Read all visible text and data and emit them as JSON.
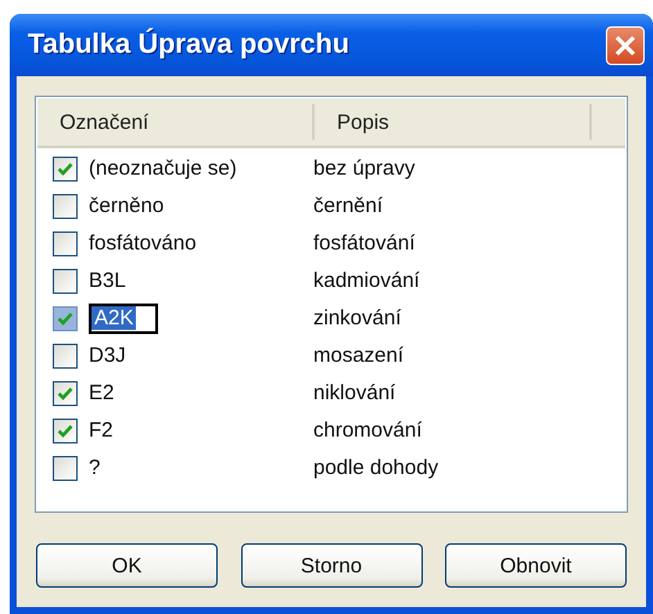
{
  "window": {
    "title": "Tabulka Úprava povrchu"
  },
  "table": {
    "columns": [
      "Označení",
      "Popis"
    ],
    "rows": [
      {
        "code": "(neoznačuje se)",
        "description": "bez úpravy",
        "checked": true,
        "editing": false
      },
      {
        "code": "černěno",
        "description": "černění",
        "checked": false,
        "editing": false
      },
      {
        "code": "fosfátováno",
        "description": "fosfátování",
        "checked": false,
        "editing": false
      },
      {
        "code": "B3L",
        "description": "kadmiování",
        "checked": false,
        "editing": false
      },
      {
        "code": "A2K",
        "description": "zinkování",
        "checked": true,
        "editing": true
      },
      {
        "code": "D3J",
        "description": "mosazení",
        "checked": false,
        "editing": false
      },
      {
        "code": "E2",
        "description": "niklování",
        "checked": true,
        "editing": false
      },
      {
        "code": "F2",
        "description": "chromování",
        "checked": true,
        "editing": false
      },
      {
        "code": "?",
        "description": "podle dohody",
        "checked": false,
        "editing": false
      }
    ]
  },
  "buttons": [
    "OK",
    "Storno",
    "Obnovit"
  ]
}
